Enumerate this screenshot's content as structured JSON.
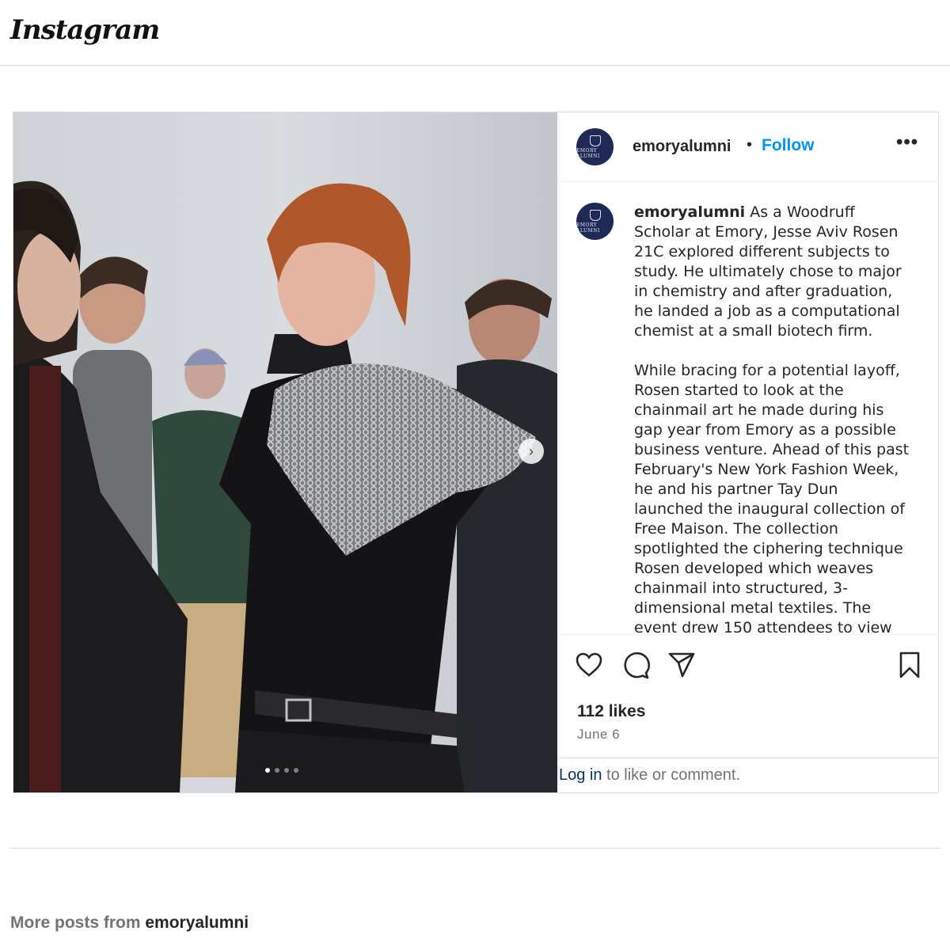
{
  "header": {
    "logo_text": "Instagram"
  },
  "post": {
    "username": "emoryalumni",
    "separator": "•",
    "follow_label": "Follow",
    "more_label": "•••",
    "avatar_text": "EMORY ALUMNI",
    "caption_username": "emoryalumni",
    "caption_paragraphs": [
      "As a Woodruff Scholar at Emory, Jesse Aviv Rosen 21C explored different subjects to study. He ultimately chose to major in chemistry and after graduation, he landed a job as a computational chemist at a small biotech firm.",
      "While bracing for a potential layoff, Rosen started to look at the chainmail art he made during his gap year from Emory as a possible business venture. Ahead of this past February's New York Fashion Week, he and his partner Tay Dun launched the inaugural collection of Free Maison. The collection spotlighted the ciphering technique Rosen developed which weaves chainmail into structured, 3-dimensional metal textiles. The event drew 150 attendees to view"
    ],
    "likes": "112 likes",
    "date": "June 6",
    "login_link": "Log in",
    "login_rest": " to like or comment.",
    "carousel": {
      "current": 1,
      "total": 4,
      "next_icon": "chevron-right-icon"
    },
    "icons": [
      "heart-icon",
      "comment-icon",
      "share-icon",
      "bookmark-icon"
    ]
  },
  "footer": {
    "more_posts_prefix": "More posts from ",
    "more_posts_user": "emoryalumni"
  },
  "colors": {
    "accent": "#0095f6",
    "link_dark": "#00376b",
    "muted": "#737373",
    "avatar_bg": "#1e2a55"
  }
}
